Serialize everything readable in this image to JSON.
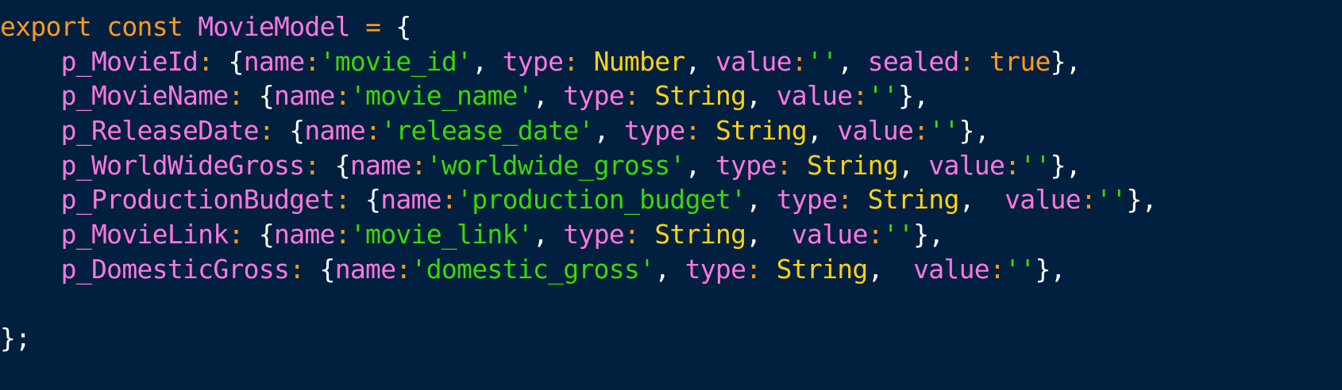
{
  "colors": {
    "background": "#012040",
    "keyword": "#ff9a1c",
    "type": "#ffd30f",
    "string": "#3ad900",
    "property": "#ff77dd",
    "punctuation": "#ffffff"
  },
  "code": {
    "lines": [
      [
        {
          "t": "export",
          "c": "keyword"
        },
        {
          "t": " ",
          "c": "punct"
        },
        {
          "t": "const",
          "c": "keyword"
        },
        {
          "t": " ",
          "c": "punct"
        },
        {
          "t": "MovieModel",
          "c": "ident"
        },
        {
          "t": " ",
          "c": "punct"
        },
        {
          "t": "=",
          "c": "keyword"
        },
        {
          "t": " {",
          "c": "punct"
        }
      ],
      [
        {
          "t": "    p_MovieId",
          "c": "prop"
        },
        {
          "t": ":",
          "c": "keyword"
        },
        {
          "t": " {",
          "c": "punct"
        },
        {
          "t": "name",
          "c": "prop"
        },
        {
          "t": ":",
          "c": "keyword"
        },
        {
          "t": "'movie_id'",
          "c": "string"
        },
        {
          "t": ", ",
          "c": "punct"
        },
        {
          "t": "type",
          "c": "prop"
        },
        {
          "t": ":",
          "c": "keyword"
        },
        {
          "t": " ",
          "c": "punct"
        },
        {
          "t": "Number",
          "c": "type"
        },
        {
          "t": ", ",
          "c": "punct"
        },
        {
          "t": "value",
          "c": "prop"
        },
        {
          "t": ":",
          "c": "keyword"
        },
        {
          "t": "''",
          "c": "string"
        },
        {
          "t": ", ",
          "c": "punct"
        },
        {
          "t": "sealed",
          "c": "prop"
        },
        {
          "t": ":",
          "c": "keyword"
        },
        {
          "t": " ",
          "c": "punct"
        },
        {
          "t": "true",
          "c": "keyword"
        },
        {
          "t": "},",
          "c": "punct"
        }
      ],
      [
        {
          "t": "    p_MovieName",
          "c": "prop"
        },
        {
          "t": ":",
          "c": "keyword"
        },
        {
          "t": " {",
          "c": "punct"
        },
        {
          "t": "name",
          "c": "prop"
        },
        {
          "t": ":",
          "c": "keyword"
        },
        {
          "t": "'movie_name'",
          "c": "string"
        },
        {
          "t": ", ",
          "c": "punct"
        },
        {
          "t": "type",
          "c": "prop"
        },
        {
          "t": ":",
          "c": "keyword"
        },
        {
          "t": " ",
          "c": "punct"
        },
        {
          "t": "String",
          "c": "type"
        },
        {
          "t": ", ",
          "c": "punct"
        },
        {
          "t": "value",
          "c": "prop"
        },
        {
          "t": ":",
          "c": "keyword"
        },
        {
          "t": "''",
          "c": "string"
        },
        {
          "t": "},",
          "c": "punct"
        }
      ],
      [
        {
          "t": "    p_ReleaseDate",
          "c": "prop"
        },
        {
          "t": ":",
          "c": "keyword"
        },
        {
          "t": " {",
          "c": "punct"
        },
        {
          "t": "name",
          "c": "prop"
        },
        {
          "t": ":",
          "c": "keyword"
        },
        {
          "t": "'release_date'",
          "c": "string"
        },
        {
          "t": ", ",
          "c": "punct"
        },
        {
          "t": "type",
          "c": "prop"
        },
        {
          "t": ":",
          "c": "keyword"
        },
        {
          "t": " ",
          "c": "punct"
        },
        {
          "t": "String",
          "c": "type"
        },
        {
          "t": ", ",
          "c": "punct"
        },
        {
          "t": "value",
          "c": "prop"
        },
        {
          "t": ":",
          "c": "keyword"
        },
        {
          "t": "''",
          "c": "string"
        },
        {
          "t": "},",
          "c": "punct"
        }
      ],
      [
        {
          "t": "    p_WorldWideGross",
          "c": "prop"
        },
        {
          "t": ":",
          "c": "keyword"
        },
        {
          "t": " {",
          "c": "punct"
        },
        {
          "t": "name",
          "c": "prop"
        },
        {
          "t": ":",
          "c": "keyword"
        },
        {
          "t": "'worldwide_gross'",
          "c": "string"
        },
        {
          "t": ", ",
          "c": "punct"
        },
        {
          "t": "type",
          "c": "prop"
        },
        {
          "t": ":",
          "c": "keyword"
        },
        {
          "t": " ",
          "c": "punct"
        },
        {
          "t": "String",
          "c": "type"
        },
        {
          "t": ", ",
          "c": "punct"
        },
        {
          "t": "value",
          "c": "prop"
        },
        {
          "t": ":",
          "c": "keyword"
        },
        {
          "t": "''",
          "c": "string"
        },
        {
          "t": "},",
          "c": "punct"
        }
      ],
      [
        {
          "t": "    p_ProductionBudget",
          "c": "prop"
        },
        {
          "t": ":",
          "c": "keyword"
        },
        {
          "t": " {",
          "c": "punct"
        },
        {
          "t": "name",
          "c": "prop"
        },
        {
          "t": ":",
          "c": "keyword"
        },
        {
          "t": "'production_budget'",
          "c": "string"
        },
        {
          "t": ", ",
          "c": "punct"
        },
        {
          "t": "type",
          "c": "prop"
        },
        {
          "t": ":",
          "c": "keyword"
        },
        {
          "t": " ",
          "c": "punct"
        },
        {
          "t": "String",
          "c": "type"
        },
        {
          "t": ",  ",
          "c": "punct"
        },
        {
          "t": "value",
          "c": "prop"
        },
        {
          "t": ":",
          "c": "keyword"
        },
        {
          "t": "''",
          "c": "string"
        },
        {
          "t": "},",
          "c": "punct"
        }
      ],
      [
        {
          "t": "    p_MovieLink",
          "c": "prop"
        },
        {
          "t": ":",
          "c": "keyword"
        },
        {
          "t": " {",
          "c": "punct"
        },
        {
          "t": "name",
          "c": "prop"
        },
        {
          "t": ":",
          "c": "keyword"
        },
        {
          "t": "'movie_link'",
          "c": "string"
        },
        {
          "t": ", ",
          "c": "punct"
        },
        {
          "t": "type",
          "c": "prop"
        },
        {
          "t": ":",
          "c": "keyword"
        },
        {
          "t": " ",
          "c": "punct"
        },
        {
          "t": "String",
          "c": "type"
        },
        {
          "t": ",  ",
          "c": "punct"
        },
        {
          "t": "value",
          "c": "prop"
        },
        {
          "t": ":",
          "c": "keyword"
        },
        {
          "t": "''",
          "c": "string"
        },
        {
          "t": "},",
          "c": "punct"
        }
      ],
      [
        {
          "t": "    p_DomesticGross",
          "c": "prop"
        },
        {
          "t": ":",
          "c": "keyword"
        },
        {
          "t": " {",
          "c": "punct"
        },
        {
          "t": "name",
          "c": "prop"
        },
        {
          "t": ":",
          "c": "keyword"
        },
        {
          "t": "'domestic_gross'",
          "c": "string"
        },
        {
          "t": ", ",
          "c": "punct"
        },
        {
          "t": "type",
          "c": "prop"
        },
        {
          "t": ":",
          "c": "keyword"
        },
        {
          "t": " ",
          "c": "punct"
        },
        {
          "t": "String",
          "c": "type"
        },
        {
          "t": ",  ",
          "c": "punct"
        },
        {
          "t": "value",
          "c": "prop"
        },
        {
          "t": ":",
          "c": "keyword"
        },
        {
          "t": "''",
          "c": "string"
        },
        {
          "t": "},",
          "c": "punct"
        }
      ],
      [],
      [
        {
          "t": "};",
          "c": "punct"
        }
      ]
    ]
  }
}
